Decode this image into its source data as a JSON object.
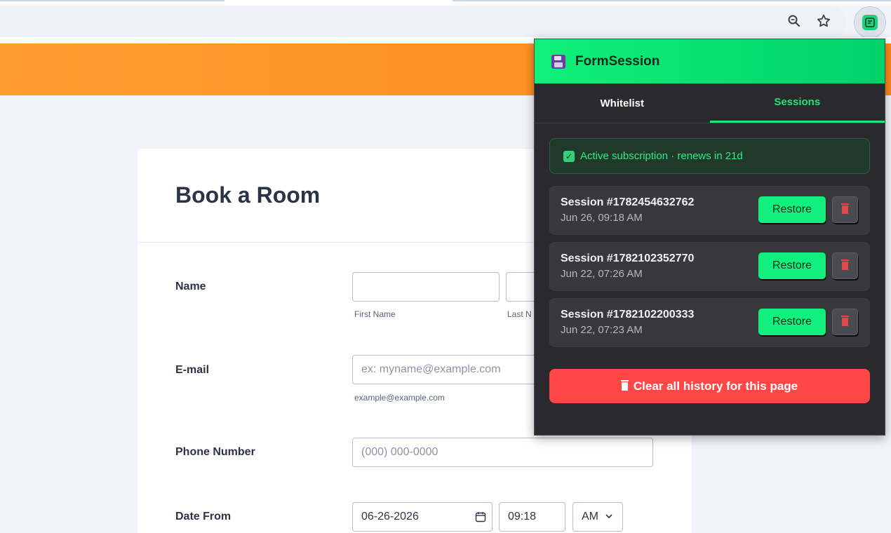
{
  "browser": {
    "icons": [
      "zoom-icon",
      "star-icon",
      "formsession-extension-icon"
    ]
  },
  "form": {
    "title": "Book a Room",
    "name_label": "Name",
    "first_name_sublabel": "First Name",
    "last_name_sublabel": "Last N",
    "email_label": "E-mail",
    "email_placeholder": "ex: myname@example.com",
    "email_sublabel": "example@example.com",
    "phone_label": "Phone Number",
    "phone_placeholder": "(000) 000-0000",
    "date_from_label": "Date From",
    "date_value": "06-26-2026",
    "time_value": "09:18",
    "ampm_value": "AM"
  },
  "popup": {
    "title": "FormSession",
    "tabs": [
      {
        "label": "Whitelist",
        "active": false
      },
      {
        "label": "Sessions",
        "active": true
      }
    ],
    "subscription_text": "Active subscription · renews in 21d",
    "sessions": [
      {
        "name": "Session #1782454632762",
        "date": "Jun 26, 09:18 AM",
        "restore_label": "Restore"
      },
      {
        "name": "Session #1782102352770",
        "date": "Jun 22, 07:26 AM",
        "restore_label": "Restore"
      },
      {
        "name": "Session #1782102200333",
        "date": "Jun 22, 07:23 AM",
        "restore_label": "Restore"
      }
    ],
    "clear_label": "Clear all history for this page"
  },
  "colors": {
    "accent_green": "#11f07c",
    "banner_orange": "#ff9d2e",
    "danger_red": "#ff4747",
    "popup_bg": "#2a2a2e"
  }
}
